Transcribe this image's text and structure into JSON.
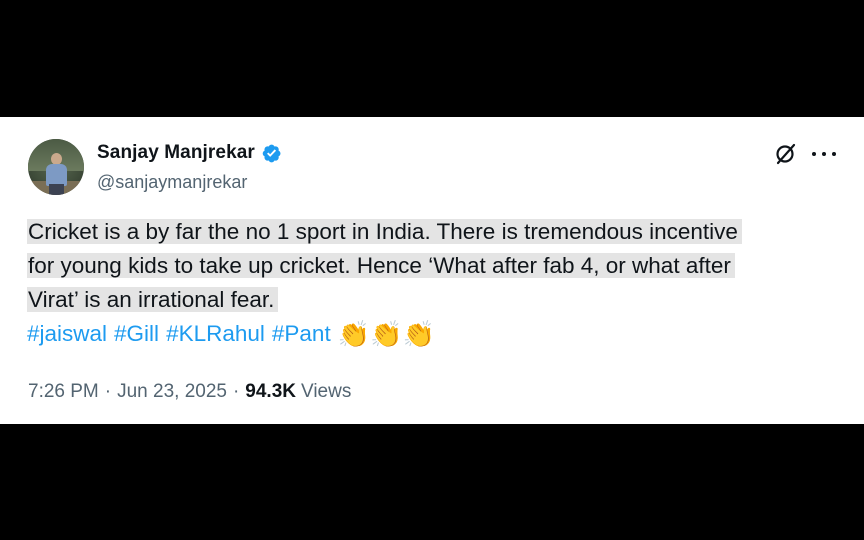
{
  "tweet": {
    "author": {
      "display_name": "Sanjay Manjrekar",
      "handle": "@sanjaymanjrekar",
      "verified": true
    },
    "text_lines": [
      "Cricket is a by far the no 1 sport in India. There is tremendous incentive",
      "for young kids to take up cricket. Hence  ‘What after fab 4, or what after",
      "Virat’ is an irrational fear."
    ],
    "hashtags": [
      "#jaiswal",
      "#Gill",
      "#KLRahul",
      "#Pant"
    ],
    "emoji": [
      "👏",
      "👏",
      "👏"
    ],
    "time": "7:26 PM",
    "separator": "·",
    "date": "Jun 23, 2025",
    "views_count": "94.3K",
    "views_label": "Views"
  },
  "icons": {
    "verified": "verified-badge-icon",
    "grok": "grok-icon",
    "more": "more-options-icon"
  },
  "colors": {
    "link": "#1d9bf0",
    "text": "#0f1419",
    "secondary": "#536471",
    "highlight": "#e4e4e4"
  }
}
